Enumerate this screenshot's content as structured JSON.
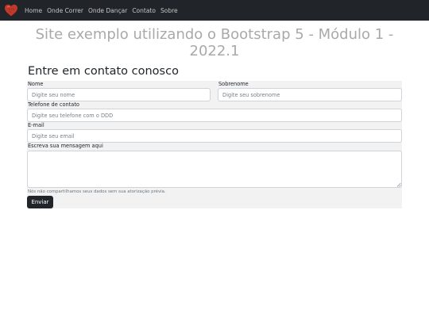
{
  "navbar": {
    "brand_icon": "heart-icon",
    "brand_color": "#c0392b",
    "links": [
      "Home",
      "Onde Correr",
      "Onde Dançar",
      "Contato",
      "Sobre"
    ]
  },
  "hero": {
    "title": "Site exemplo utilizando o Bootstrap 5 - Módulo 1 - 2022.1"
  },
  "contact": {
    "title": "Entre em contato conosco",
    "fields": {
      "nome": {
        "label": "Nome",
        "placeholder": "Digite seu nome"
      },
      "sobrenome": {
        "label": "Sobrenome",
        "placeholder": "Digite seu sobrenome"
      },
      "telefone": {
        "label": "Telefone de contato",
        "placeholder": "Digite seu telefone com o DDD"
      },
      "email": {
        "label": "E-mail",
        "placeholder": "Digite seu email"
      },
      "mensagem": {
        "label": "Escreva sua mensagem aqui",
        "placeholder": ""
      }
    },
    "help_text": "Nós não compartilhamos seus dados sem sua atorização prévia.",
    "submit_label": "Enviar"
  },
  "colors": {
    "navbar_bg": "#212529",
    "hero_text": "#a7a9ab",
    "form_bg": "#f2f2f2",
    "button_bg": "#212529"
  }
}
